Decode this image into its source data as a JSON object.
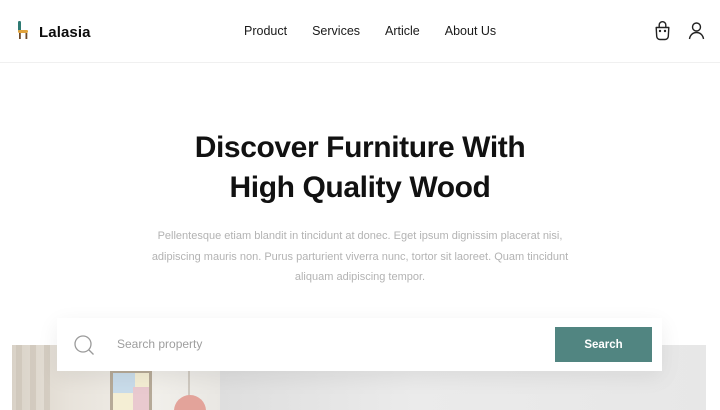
{
  "brand": {
    "name": "Lalasia",
    "icon": "chair-icon",
    "accent": "#518581"
  },
  "nav": [
    {
      "label": "Product"
    },
    {
      "label": "Services"
    },
    {
      "label": "Article"
    },
    {
      "label": "About Us"
    }
  ],
  "header_icons": {
    "cart": "shopping-bag-icon",
    "profile": "user-icon"
  },
  "hero": {
    "title_line1": "Discover Furniture With",
    "title_line2": "High Quality Wood",
    "description": "Pellentesque etiam blandit in tincidunt at donec. Eget ipsum dignissim placerat nisi, adipiscing mauris non. Purus parturient viverra nunc, tortor sit laoreet. Quam tincidunt aliquam adipiscing tempor."
  },
  "search": {
    "placeholder": "Search property",
    "value": "",
    "button_label": "Search",
    "icon": "search-icon",
    "button_color": "#518581"
  }
}
